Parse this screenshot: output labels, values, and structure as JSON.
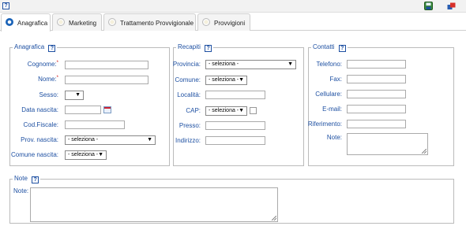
{
  "topbar": {
    "help_glyph": "?",
    "icons": [
      "save-icon",
      "exit-icon"
    ]
  },
  "tabs": [
    {
      "label": "Anagrafica",
      "active": true
    },
    {
      "label": "Marketing",
      "active": false
    },
    {
      "label": "Trattamento Provvigionale",
      "active": false
    },
    {
      "label": "Provvigioni",
      "active": false
    }
  ],
  "anagrafica": {
    "legend": "Anagrafica",
    "cognome_label": "Cognome:",
    "nome_label": "Nome:",
    "required_mark": "*",
    "sesso_label": "Sesso:",
    "sesso_value": "",
    "data_nascita_label": "Data nascita:",
    "cod_fiscale_label": "Cod.Fiscale:",
    "prov_nascita_label": "Prov. nascita:",
    "prov_nascita_value": "- seleziona -",
    "comune_nascita_label": "Comune nascita:",
    "comune_nascita_value": "- seleziona -"
  },
  "recapiti": {
    "legend": "Recapiti",
    "provincia_label": "Provincia:",
    "provincia_value": "- seleziona -",
    "comune_label": "Comune:",
    "comune_value": "- seleziona -",
    "localita_label": "Località:",
    "cap_label": "CAP:",
    "cap_value": "- seleziona -",
    "presso_label": "Presso:",
    "indirizzo_label": "Indirizzo:"
  },
  "contatti": {
    "legend": "Contatti",
    "telefono_label": "Telefono:",
    "fax_label": "Fax:",
    "cellulare_label": "Cellulare:",
    "email_label": "E-mail:",
    "riferimento_label": "Riferimento:",
    "note_label": "Note:"
  },
  "note_section": {
    "legend": "Note",
    "note_label": "Note:"
  },
  "select_arrow": "▼",
  "colors": {
    "label_blue": "#1e50a2",
    "required_red": "#c00",
    "tab_active_radio": "#1b63b8"
  }
}
